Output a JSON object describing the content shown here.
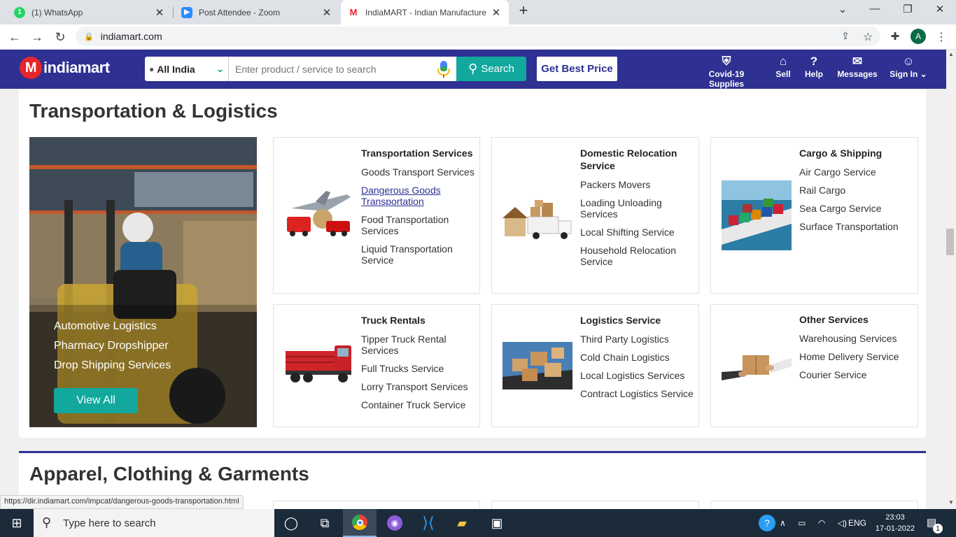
{
  "browser": {
    "tabs": [
      {
        "title": "(1) WhatsApp",
        "favicon": "whatsapp-icon",
        "color": "#25d366"
      },
      {
        "title": "Post Attendee - Zoom",
        "favicon": "zoom-icon",
        "color": "#2d8cff"
      },
      {
        "title": "IndiaMART - Indian Manufacture",
        "favicon": "indiamart-icon",
        "color": "#e5242b"
      }
    ],
    "new_tab": "+",
    "url": "indiamart.com",
    "status_url": "https://dir.indiamart.com/impcat/dangerous-goods-transportation.html",
    "profile_initial": "A"
  },
  "header": {
    "logo": "indiamart",
    "location": "All India",
    "search_placeholder": "Enter product / service to search",
    "search_button": "Search",
    "best_price": "Get Best Price",
    "nav": [
      {
        "label": "Covid-19 Supplies",
        "icon": "shield-icon"
      },
      {
        "label": "Sell",
        "icon": "store-icon"
      },
      {
        "label": "Help",
        "icon": "help-icon"
      },
      {
        "label": "Messages",
        "icon": "messages-icon"
      },
      {
        "label": "Sign In",
        "icon": "user-icon"
      }
    ],
    "brand_color": "#2e3192",
    "accent_color": "#12a89d"
  },
  "section": {
    "title": "Transportation & Logistics",
    "hero_links": [
      "Automotive Logistics",
      "Pharmacy Dropshipper",
      "Drop Shipping Services"
    ],
    "view_all": "View All",
    "cards": [
      {
        "title": "Transportation Services",
        "image": "cargo-plane-truck-image",
        "links": [
          "Goods Transport Services",
          "Dangerous Goods Transportation",
          "Food Transportation Services",
          "Liquid Transportation Service"
        ]
      },
      {
        "title": "Domestic Relocation Service",
        "image": "moving-truck-house-image",
        "links": [
          "Packers Movers",
          "Loading Unloading Services",
          "Local Shifting Service",
          "Household Relocation Service"
        ]
      },
      {
        "title": "Cargo & Shipping",
        "image": "container-ship-image",
        "links": [
          "Air Cargo Service",
          "Rail Cargo",
          "Sea Cargo Service",
          "Surface Transportation"
        ]
      },
      {
        "title": "Truck Rentals",
        "image": "red-truck-image",
        "links": [
          "Tipper Truck Rental Services",
          "Full Trucks Service",
          "Lorry Transport Services",
          "Container Truck Service"
        ]
      },
      {
        "title": "Logistics Service",
        "image": "boxes-laptop-image",
        "links": [
          "Third Party Logistics",
          "Cold Chain Logistics",
          "Local Logistics Services",
          "Contract Logistics Service"
        ]
      },
      {
        "title": "Other Services",
        "image": "parcel-handover-image",
        "links": [
          "Warehousing Services",
          "Home Delivery Service",
          "Courier Service"
        ]
      }
    ]
  },
  "section2": {
    "title": "Apparel, Clothing & Garments"
  },
  "taskbar": {
    "search_placeholder": "Type here to search",
    "language": "ENG",
    "time": "23:03",
    "date": "17-01-2022",
    "notification_count": "1"
  }
}
